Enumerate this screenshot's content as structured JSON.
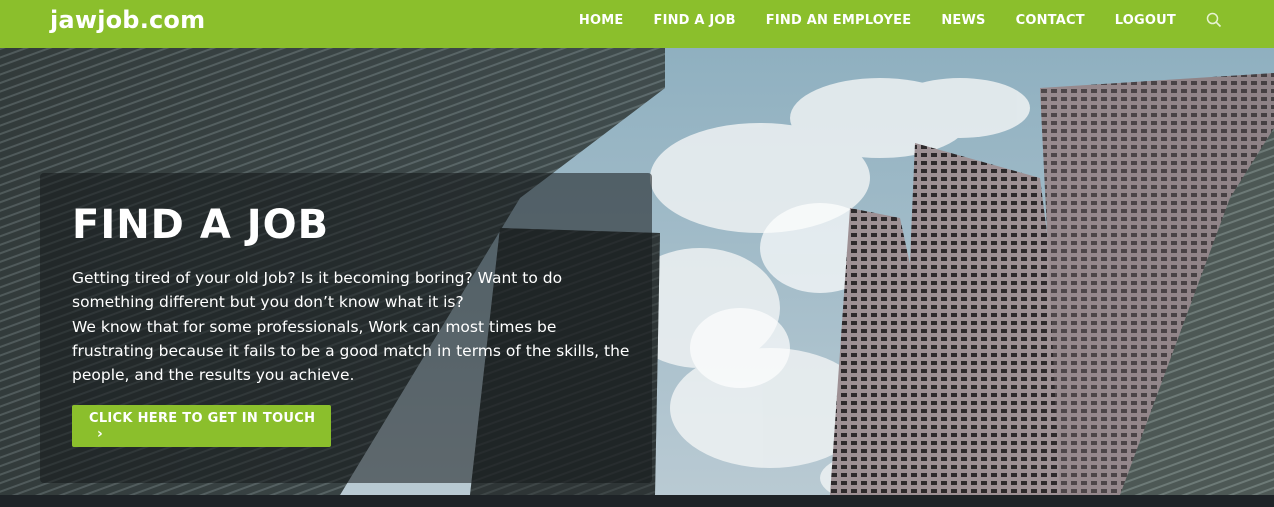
{
  "site": {
    "logo": "jawjob.com"
  },
  "nav": {
    "items": [
      "HOME",
      "FIND A JOB",
      "FIND AN EMPLOYEE",
      "NEWS",
      "CONTACT",
      "LOGOUT"
    ],
    "search_icon": "search-icon"
  },
  "hero": {
    "title": "FIND A JOB",
    "paragraphs": [
      "Getting tired of your old Job? Is it becoming boring? Want to do something different but you don’t know what it is?",
      "We know that for some professionals, Work can most times be frustrating because it fails to be a good match in terms of the skills, the people, and the results you achieve."
    ],
    "cta_label": "CLICK HERE TO GET IN TOUCH",
    "cta_icon": "chevron-right-icon"
  },
  "colors": {
    "accent": "#8bbf2c",
    "text": "#ffffff"
  }
}
